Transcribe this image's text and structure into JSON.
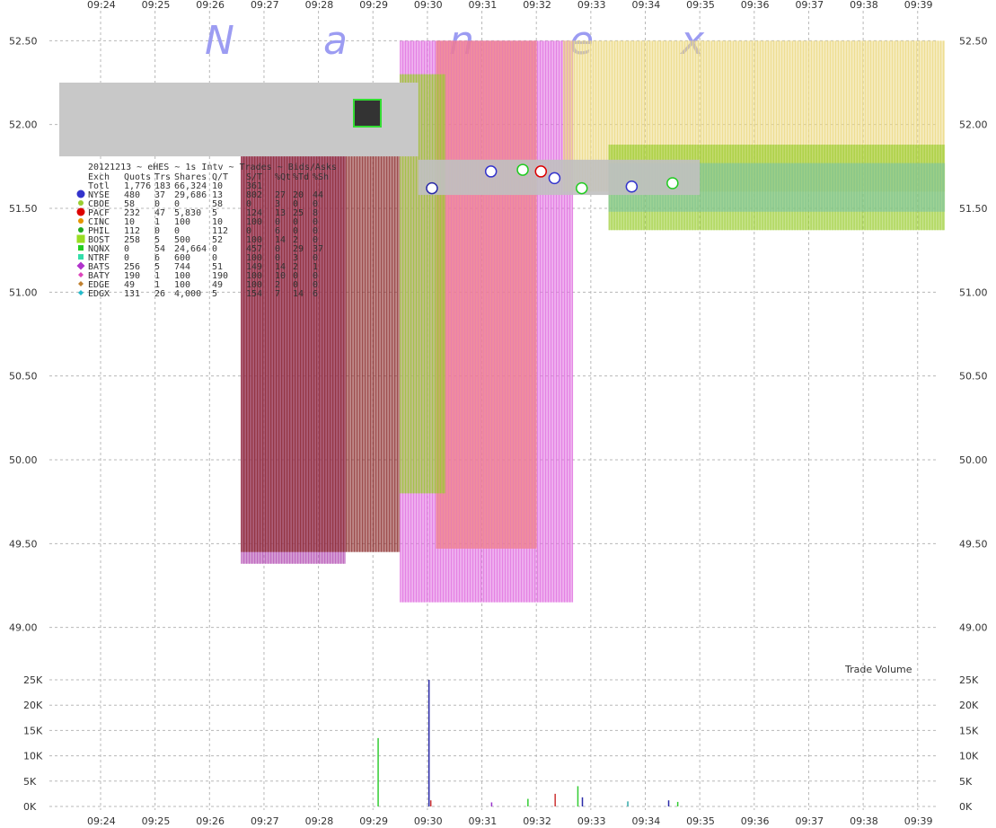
{
  "watermark": {
    "text": "Nanex",
    "letters": [
      "N",
      "a",
      "n",
      "e",
      "x"
    ]
  },
  "chart_data": {
    "type": "area",
    "x_ticks": [
      "09:24",
      "09:25",
      "09:26",
      "09:27",
      "09:28",
      "09:29",
      "09:30",
      "09:31",
      "09:32",
      "09:33",
      "09:34",
      "09:35",
      "09:36",
      "09:37",
      "09:38",
      "09:39"
    ],
    "price_ticks": [
      "52.50",
      "52.00",
      "51.50",
      "51.00",
      "50.50",
      "50.00",
      "49.50",
      "49.00"
    ],
    "price_range": [
      48.8,
      52.55
    ],
    "volume_ticks": [
      "25K",
      "20K",
      "15K",
      "10K",
      "5K",
      "0K"
    ],
    "volume_range": [
      0,
      25000
    ],
    "volume_label": "Trade Volume",
    "grid": true,
    "volume_bars": [
      {
        "time": "09:29:05",
        "volume": 13500,
        "color": "#33cc33"
      },
      {
        "time": "09:30:01",
        "volume": 25000,
        "color": "#2a2aa8"
      },
      {
        "time": "09:30:03",
        "volume": 1200,
        "color": "#cc3333"
      },
      {
        "time": "09:31:10",
        "volume": 800,
        "color": "#9933cc"
      },
      {
        "time": "09:31:50",
        "volume": 1500,
        "color": "#33cc33"
      },
      {
        "time": "09:32:20",
        "volume": 2500,
        "color": "#cc3333"
      },
      {
        "time": "09:32:45",
        "volume": 4000,
        "color": "#33cc33"
      },
      {
        "time": "09:32:50",
        "volume": 1800,
        "color": "#2a2aa8"
      },
      {
        "time": "09:33:40",
        "volume": 1000,
        "color": "#33aaaa"
      },
      {
        "time": "09:34:25",
        "volume": 1200,
        "color": "#2a2aa8"
      },
      {
        "time": "09:34:35",
        "volume": 900,
        "color": "#33cc33"
      }
    ],
    "quote_bands": [
      {
        "name": "NYSE",
        "color": "#b34db3",
        "start": "09:26:35",
        "end": "09:28:30",
        "bid": 49.38,
        "ask": 52.25
      },
      {
        "name": "PACF",
        "color": "#8b2a2a",
        "start": "09:26:35",
        "end": "09:29:30",
        "bid": 49.45,
        "ask": 52.25
      },
      {
        "name": "BATS",
        "color": "#e06ee0",
        "start": "09:29:30",
        "end": "09:32:40",
        "bid": 49.15,
        "ask": 52.5
      },
      {
        "name": "EDGE",
        "color": "#f08080",
        "start": "09:30:10",
        "end": "09:32:00",
        "bid": 49.47,
        "ask": 52.5
      },
      {
        "name": "CBOE",
        "color": "#9acd32",
        "start": "09:29:30",
        "end": "09:30:20",
        "bid": 49.8,
        "ask": 52.3
      },
      {
        "name": "BATY",
        "color": "#ecd984",
        "start": "09:32:30",
        "end": "09:39:30",
        "bid": 51.6,
        "ask": 52.5
      },
      {
        "name": "NQNX",
        "color": "#9acd32",
        "start": "09:33:20",
        "end": "09:39:30",
        "bid": 51.37,
        "ask": 51.88
      },
      {
        "name": "NTRF",
        "color": "#7ec49a",
        "start": "09:33:20",
        "end": "09:39:30",
        "bid": 51.48,
        "ask": 51.77
      }
    ],
    "nbbo_band": {
      "start": "09:29:50",
      "end": "09:35:00",
      "low": 51.58,
      "high": 51.79,
      "color": "#c0c0c0"
    }
  },
  "legend": {
    "header": "20121213 ~ eHES ~ 1s Intv ~ Trades ~ Bids/Asks",
    "columns": [
      "Exch",
      "Quots",
      "Trs",
      "Shares",
      "Q/T",
      "S/T",
      "%Qt",
      "%Td",
      "%Sh"
    ],
    "rows": [
      {
        "exch": "Totl",
        "quots": "1,776",
        "trs": "183",
        "shares": "66,324",
        "qt": "10",
        "st": "361",
        "pqt": "",
        "ptd": "",
        "psh": "",
        "color": "",
        "marker": "none"
      },
      {
        "exch": "NYSE",
        "quots": "480",
        "trs": "37",
        "shares": "29,686",
        "qt": "13",
        "st": "802",
        "pqt": "27",
        "ptd": "20",
        "psh": "44",
        "color": "#3333cc",
        "marker": "circle-lg"
      },
      {
        "exch": "CBOE",
        "quots": "58",
        "trs": "0",
        "shares": "0",
        "qt": "58",
        "st": "0",
        "pqt": "3",
        "ptd": "0",
        "psh": "0",
        "color": "#9acd32",
        "marker": "circle-sm"
      },
      {
        "exch": "PACF",
        "quots": "232",
        "trs": "47",
        "shares": "5,830",
        "qt": "5",
        "st": "124",
        "pqt": "13",
        "ptd": "25",
        "psh": "8",
        "color": "#dd0000",
        "marker": "circle-lg"
      },
      {
        "exch": "CINC",
        "quots": "10",
        "trs": "1",
        "shares": "100",
        "qt": "10",
        "st": "100",
        "pqt": "0",
        "ptd": "0",
        "psh": "0",
        "color": "#e69500",
        "marker": "circle-sm"
      },
      {
        "exch": "PHIL",
        "quots": "112",
        "trs": "0",
        "shares": "0",
        "qt": "112",
        "st": "0",
        "pqt": "6",
        "ptd": "0",
        "psh": "0",
        "color": "#22aa22",
        "marker": "circle-sm"
      },
      {
        "exch": "BOST",
        "quots": "258",
        "trs": "5",
        "shares": "500",
        "qt": "52",
        "st": "100",
        "pqt": "14",
        "ptd": "2",
        "psh": "0",
        "color": "#99dd22",
        "marker": "square-lg"
      },
      {
        "exch": "NQNX",
        "quots": "0",
        "trs": "54",
        "shares": "24,664",
        "qt": "0",
        "st": "457",
        "pqt": "0",
        "ptd": "29",
        "psh": "37",
        "color": "#22cc22",
        "marker": "square-sm"
      },
      {
        "exch": "NTRF",
        "quots": "0",
        "trs": "6",
        "shares": "600",
        "qt": "0",
        "st": "100",
        "pqt": "0",
        "ptd": "3",
        "psh": "0",
        "color": "#33ddaa",
        "marker": "square-sm"
      },
      {
        "exch": "BATS",
        "quots": "256",
        "trs": "5",
        "shares": "744",
        "qt": "51",
        "st": "149",
        "pqt": "14",
        "ptd": "2",
        "psh": "1",
        "color": "#b133cc",
        "marker": "diamond-lg"
      },
      {
        "exch": "BATY",
        "quots": "190",
        "trs": "1",
        "shares": "100",
        "qt": "190",
        "st": "100",
        "pqt": "10",
        "ptd": "0",
        "psh": "0",
        "color": "#dd44bb",
        "marker": "diamond-sm"
      },
      {
        "exch": "EDGE",
        "quots": "49",
        "trs": "1",
        "shares": "100",
        "qt": "49",
        "st": "100",
        "pqt": "2",
        "ptd": "0",
        "psh": "0",
        "color": "#c08030",
        "marker": "diamond-sm"
      },
      {
        "exch": "EDGX",
        "quots": "131",
        "trs": "26",
        "shares": "4,000",
        "qt": "5",
        "st": "154",
        "pqt": "7",
        "ptd": "14",
        "psh": "6",
        "color": "#22bbcc",
        "marker": "diamond-sm"
      }
    ]
  }
}
